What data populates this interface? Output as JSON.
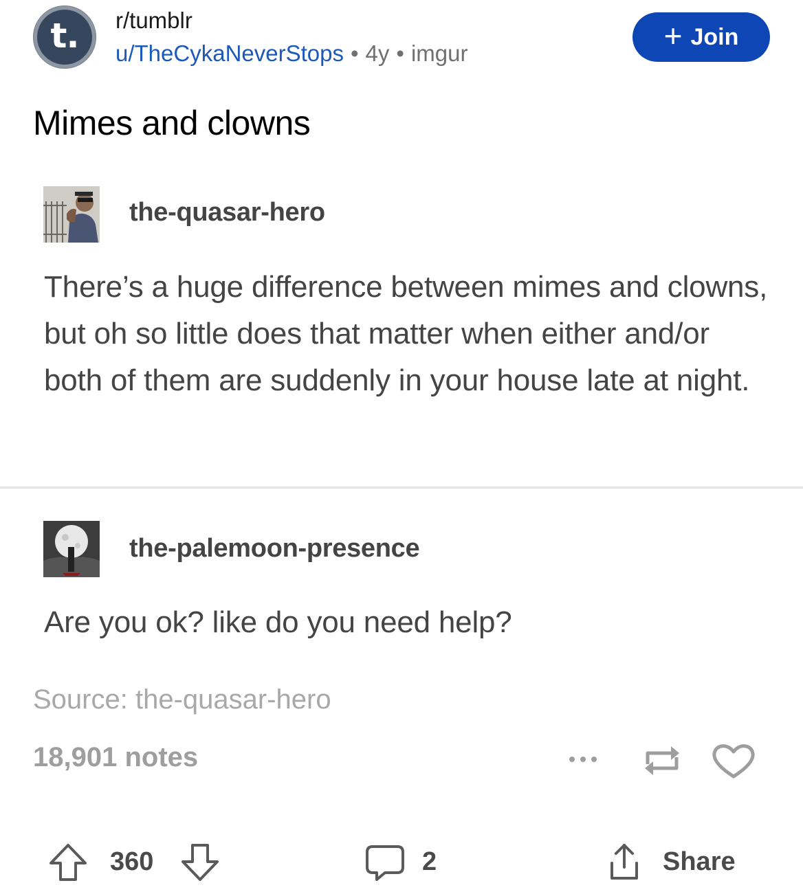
{
  "header": {
    "avatar_letter": "t.",
    "subreddit": "r/tumblr",
    "username": "u/TheCykaNeverStops",
    "age": "4y",
    "source_domain": "imgur",
    "separator": "•",
    "join_plus": "+",
    "join_label": "Join"
  },
  "post": {
    "title": "Mimes and clowns"
  },
  "tumblr_post": {
    "entries": [
      {
        "blog_name": "the-quasar-hero",
        "text": "There’s a huge difference between mimes and clowns, but oh so little does that matter when either and/or both of them are suddenly in your house late at night."
      },
      {
        "blog_name": "the-palemoon-presence",
        "text": "Are you ok? like do you need help?"
      }
    ],
    "source": "Source: the-quasar-hero",
    "notes": "18,901 notes",
    "icons": [
      "more-icon",
      "reblog-icon",
      "heart-icon"
    ]
  },
  "actions": {
    "score": "360",
    "comments": "2",
    "share_label": "Share",
    "icons": [
      "upvote-icon",
      "downvote-icon",
      "comment-icon",
      "share-icon"
    ]
  },
  "colors": {
    "join_button": "#0f46b5",
    "username_link": "#1c59bb",
    "tumblr_navy": "#36465d",
    "tumblr_text": "#444444",
    "muted_text": "#a8a8a8"
  }
}
